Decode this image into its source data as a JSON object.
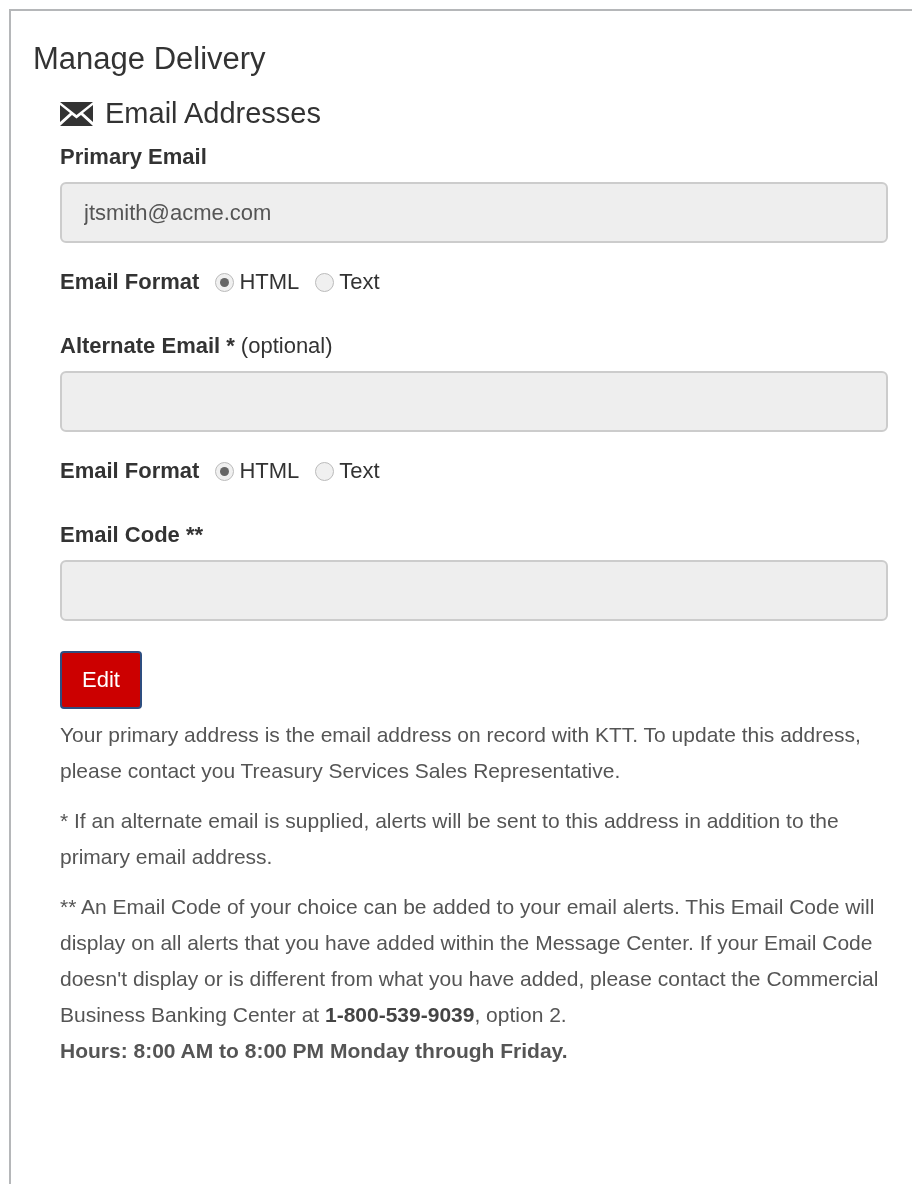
{
  "panel": {
    "title": "Manage Delivery"
  },
  "section": {
    "title": "Email Addresses"
  },
  "fields": [
    {
      "label": "Primary Email",
      "value": "jtsmith@acme.com",
      "format": {
        "label": "Email Format",
        "options": [
          {
            "label": "HTML",
            "selected": true
          },
          {
            "label": "Text",
            "selected": false
          }
        ]
      }
    },
    {
      "label": "Alternate Email *",
      "hint": "(optional)",
      "format": {
        "label": "Email Format",
        "options": [
          {
            "label": "HTML",
            "selected": true
          },
          {
            "label": "Text",
            "selected": false
          }
        ]
      }
    },
    {
      "label": "Email Code **"
    }
  ],
  "edit_button": "Edit",
  "notes": [
    "Your primary address is the email address on record with KTT. To update this address, please contact you Treasury Services Sales Representative.",
    "* If an alternate email is supplied, alerts will be sent to this address in addition to the primary email address.",
    "** An Email Code of your choice can be added to your email alerts. This Email Code will display on all alerts that you have added within the Message Center. If your Email Code doesn't display or is different from what you have added, please contact the Commercial Business Banking Center at **1-800-539-9039**, option 2."
  ],
  "hours": "Hours: 8:00 AM to 8:00 PM Monday through Friday."
}
